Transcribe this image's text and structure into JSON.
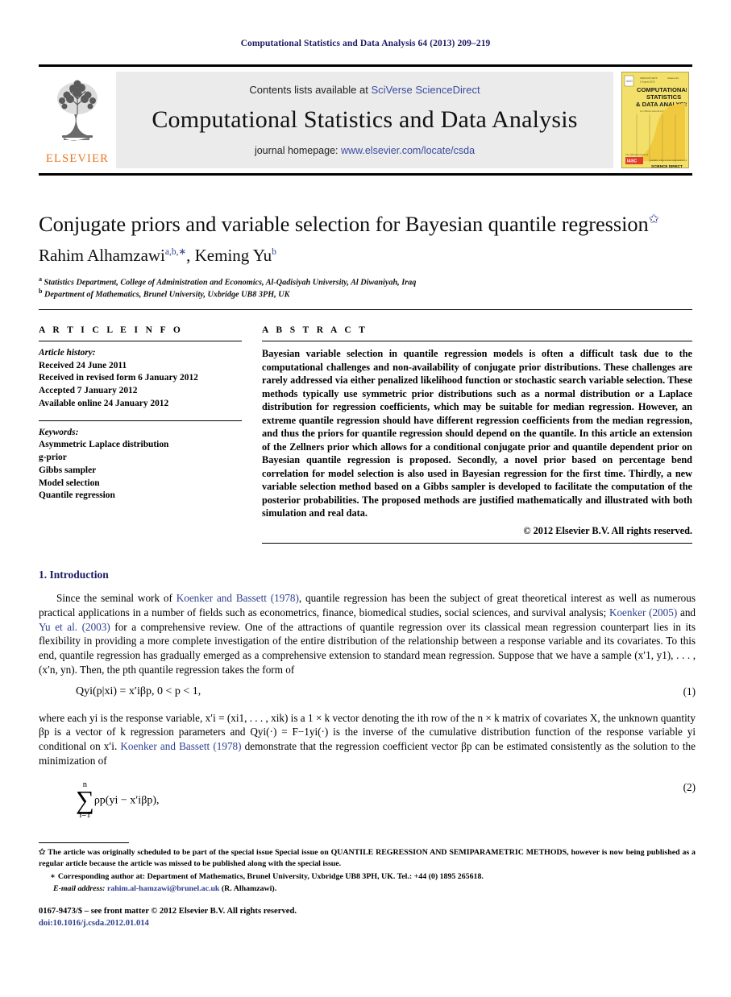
{
  "running_head": "Computational Statistics and Data Analysis 64 (2013) 209–219",
  "banner": {
    "publisher_name": "ELSEVIER",
    "contents_prefix": "Contents lists available at ",
    "contents_link": "SciVerse ScienceDirect",
    "journal_title": "Computational Statistics and Data Analysis",
    "homepage_prefix": "journal homepage: ",
    "homepage_link": "www.elsevier.com/locate/csda",
    "cover": {
      "line1": "COMPUTATIONAL",
      "line2": "STATISTICS",
      "line3": "& DATA ANALYSIS",
      "subtitle": "An Official Journal of the International Association for Statistical Computing",
      "issn_note": "ISSN 0167-9473",
      "bottom_note": "available online at www.sciencedirect.com",
      "brand": "ELSEVIER"
    }
  },
  "article": {
    "title": "Conjugate priors and variable selection for Bayesian quantile regression",
    "title_footnote_marker": "✩",
    "authors": [
      {
        "name": "Rahim Alhamzawi",
        "sup": "a,b,∗"
      },
      {
        "name": "Keming Yu",
        "sup": "b"
      }
    ],
    "affiliations": [
      {
        "marker": "a",
        "text": "Statistics Department, College of Administration and Economics, Al-Qadisiyah University, Al Diwaniyah, Iraq"
      },
      {
        "marker": "b",
        "text": "Department of Mathematics, Brunel University, Uxbridge UB8 3PH, UK"
      }
    ]
  },
  "article_info": {
    "heading": "A R T I C L E   I N F O",
    "history_label": "Article history:",
    "history": [
      "Received 24 June 2011",
      "Received in revised form 6 January 2012",
      "Accepted 7 January 2012",
      "Available online 24 January 2012"
    ],
    "keywords_label": "Keywords:",
    "keywords": [
      "Asymmetric Laplace distribution",
      "g-prior",
      "Gibbs sampler",
      "Model selection",
      "Quantile regression"
    ]
  },
  "abstract": {
    "heading": "A B S T R A C T",
    "text": "Bayesian variable selection in quantile regression models is often a difficult task due to the computational challenges and non-availability of conjugate prior distributions. These challenges are rarely addressed via either penalized likelihood function or stochastic search variable selection. These methods typically use symmetric prior distributions such as a normal distribution or a Laplace distribution for regression coefficients, which may be suitable for median regression. However, an extreme quantile regression should have different regression coefficients from the median regression, and thus the priors for quantile regression should depend on the quantile. In this article an extension of the Zellners prior which allows for a conditional conjugate prior and quantile dependent prior on Bayesian quantile regression is proposed. Secondly, a novel prior based on percentage bend correlation for model selection is also used in Bayesian regression for the first time. Thirdly, a new variable selection method based on a Gibbs sampler is developed to facilitate the computation of the posterior probabilities. The proposed methods are justified mathematically and illustrated with both simulation and real data.",
    "copyright": "© 2012 Elsevier B.V. All rights reserved."
  },
  "body": {
    "section_number_title": "1.  Introduction",
    "paragraph1_parts": {
      "p1": "Since the seminal work of ",
      "cite1": "Koenker and Bassett (1978)",
      "p2": ", quantile regression has been the subject of great theoretical interest as well as numerous practical applications in a number of fields such as econometrics, finance, biomedical studies, social sciences, and survival analysis; ",
      "cite2": "Koenker (2005)",
      "p3": " and ",
      "cite3": "Yu et al. (2003)",
      "p4": " for a comprehensive review. One of the attractions of quantile regression over its classical mean regression counterpart lies in its flexibility in providing a more complete investigation of the entire distribution of the relationship between a response variable and its covariates. To this end, quantile regression has gradually emerged as a comprehensive extension to standard mean regression. Suppose that we have a sample (x′1, y1), . . . , (x′n, yn). Then, the pth quantile regression takes the form of"
    },
    "equation1": {
      "number": "(1)",
      "text": "Qyi(p|xi) = x′iβp,   0 < p < 1,"
    },
    "paragraph2_parts": {
      "p1": "where each yi is the response variable, x′i = (xi1, . . . , xik) is a 1 × k vector denoting the ith row of the n × k matrix of covariates X, the unknown quantity βp is a vector of k regression parameters and Qyi(·) = F−1yi(·) is the inverse of the cumulative distribution function of the response variable yi conditional on x′i. ",
      "cite1": "Koenker and Bassett (1978)",
      "p2": " demonstrate that the regression coefficient vector βp can be estimated consistently as the solution to the minimization of"
    },
    "equation2": {
      "number": "(2)",
      "sum_top": "n",
      "sum_bottom": "i=1",
      "text": "ρp(yi − x′iβp),"
    }
  },
  "footnotes": [
    {
      "marker": "✩",
      "text": "The article was originally scheduled to be part of the special issue Special issue on QUANTILE REGRESSION AND SEMIPARAMETRIC METHODS, however is now being published as a regular article because the article was missed to be published along with the special issue."
    },
    {
      "marker": "∗",
      "text": "Corresponding author at: Department of Mathematics, Brunel University, Uxbridge UB8 3PH, UK. Tel.: +44 (0) 1895 265618."
    }
  ],
  "email_note": {
    "label": "E-mail address:",
    "address": "rahim.al-hamzawi@brunel.ac.uk",
    "suffix": " (R. Alhamzawi)."
  },
  "page_footer": {
    "line1": "0167-9473/$ – see front matter © 2012 Elsevier B.V. All rights reserved.",
    "doi": "doi:10.1016/j.csda.2012.01.014"
  },
  "colors": {
    "link": "#2f3f8f",
    "header_navy": "#1b1b64",
    "elsevier_orange": "#E87722",
    "banner_gray": "#ebebeb",
    "cover_yellow": "#f2e06a"
  }
}
